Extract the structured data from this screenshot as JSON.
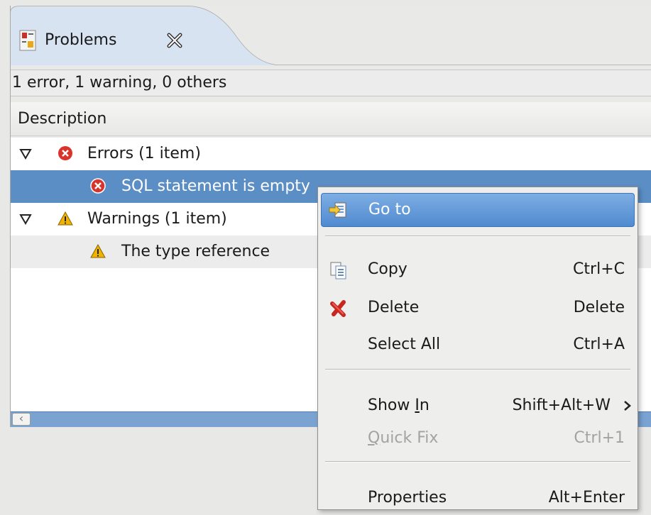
{
  "tab": {
    "title": "Problems",
    "icon": "problems-view-icon",
    "close_icon": "close-tab-icon"
  },
  "status": {
    "summary": "1 error, 1 warning, 0 others"
  },
  "table": {
    "column": "Description",
    "rows": [
      {
        "label": "Errors (1 item)",
        "icon": "error-icon",
        "expanded": true
      },
      {
        "label": "SQL statement is empty",
        "icon": "error-icon",
        "selected": true
      },
      {
        "label": "Warnings (1 item)",
        "icon": "warning-icon",
        "expanded": true
      },
      {
        "label": "The type reference",
        "icon": "warning-icon"
      }
    ]
  },
  "context_menu": {
    "items": [
      {
        "label": "Go to",
        "icon": "go-to-icon",
        "highlighted": true
      },
      {
        "label": "Copy",
        "shortcut": "Ctrl+C",
        "icon": "copy-icon"
      },
      {
        "label": "Delete",
        "shortcut": "Delete",
        "icon": "delete-icon"
      },
      {
        "label": "Select All",
        "shortcut": "Ctrl+A"
      },
      {
        "label_before": "Show ",
        "label_mnemonic": "I",
        "label_after": "n",
        "shortcut": "Shift+Alt+W",
        "submenu_icon": "chevron-right-icon"
      },
      {
        "label_mnemonic": "Q",
        "label_after": "uick Fix",
        "shortcut": "Ctrl+1",
        "disabled": true
      },
      {
        "label": "Properties",
        "shortcut": "Alt+Enter"
      }
    ]
  },
  "colors": {
    "selection": "#5c8ec6",
    "menu_highlight": "#5f95d6",
    "error": "#d9342b",
    "warning": "#f0b400",
    "scrollbar": "#7aa3d2"
  }
}
